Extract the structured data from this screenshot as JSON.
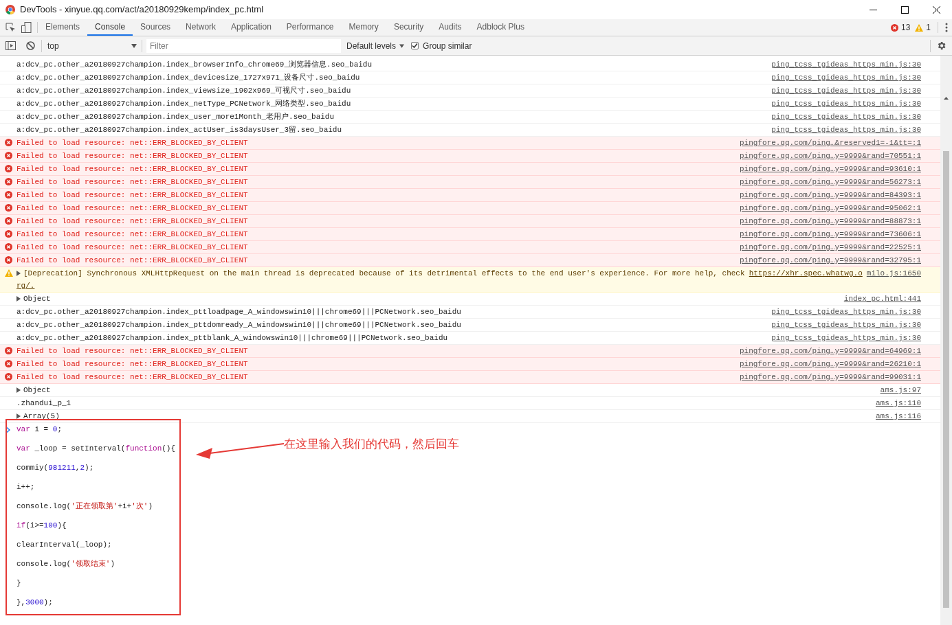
{
  "window": {
    "title": "DevTools - xinyue.qq.com/act/a20180929kemp/index_pc.html"
  },
  "tabs": [
    {
      "label": "Elements",
      "selected": false
    },
    {
      "label": "Console",
      "selected": true
    },
    {
      "label": "Sources",
      "selected": false
    },
    {
      "label": "Network",
      "selected": false
    },
    {
      "label": "Application",
      "selected": false
    },
    {
      "label": "Performance",
      "selected": false
    },
    {
      "label": "Memory",
      "selected": false
    },
    {
      "label": "Security",
      "selected": false
    },
    {
      "label": "Audits",
      "selected": false
    },
    {
      "label": "Adblock Plus",
      "selected": false
    }
  ],
  "counts": {
    "errors": "13",
    "warnings": "1"
  },
  "toolbar": {
    "context": "top",
    "filter_placeholder": "Filter",
    "levels": "Default levels",
    "group_similar": {
      "label": "Group similar",
      "checked": true
    }
  },
  "messages": [
    {
      "kind": "log",
      "text": "a:dcv_pc.other_a20180927champion.index_browserInfo_chrome69_浏览器信息.seo_baidu",
      "source": "ping_tcss_tgideas_https_min.js:30"
    },
    {
      "kind": "log",
      "text": "a:dcv_pc.other_a20180927champion.index_devicesize_1727x971_设备尺寸.seo_baidu",
      "source": "ping_tcss_tgideas_https_min.js:30"
    },
    {
      "kind": "log",
      "text": "a:dcv_pc.other_a20180927champion.index_viewsize_1902x969_可视尺寸.seo_baidu",
      "source": "ping_tcss_tgideas_https_min.js:30"
    },
    {
      "kind": "log",
      "text": "a:dcv_pc.other_a20180927champion.index_netType_PCNetwork_网络类型.seo_baidu",
      "source": "ping_tcss_tgideas_https_min.js:30"
    },
    {
      "kind": "log",
      "text": "a:dcv_pc.other_a20180927champion.index_user_more1Month_老用户.seo_baidu",
      "source": "ping_tcss_tgideas_https_min.js:30"
    },
    {
      "kind": "log",
      "text": "a:dcv_pc.other_a20180927champion.index_actUser_is3daysUser_3留.seo_baidu",
      "source": "ping_tcss_tgideas_https_min.js:30"
    },
    {
      "kind": "error",
      "text": "Failed to load resource: net::ERR_BLOCKED_BY_CLIENT",
      "source": "pingfore.qq.com/ping…&reserved1=-1&tt=:1"
    },
    {
      "kind": "error",
      "text": "Failed to load resource: net::ERR_BLOCKED_BY_CLIENT",
      "source": "pingfore.qq.com/ping…y=9999&rand=70551:1"
    },
    {
      "kind": "error",
      "text": "Failed to load resource: net::ERR_BLOCKED_BY_CLIENT",
      "source": "pingfore.qq.com/ping…y=9999&rand=93610:1"
    },
    {
      "kind": "error",
      "text": "Failed to load resource: net::ERR_BLOCKED_BY_CLIENT",
      "source": "pingfore.qq.com/ping…y=9999&rand=56273:1"
    },
    {
      "kind": "error",
      "text": "Failed to load resource: net::ERR_BLOCKED_BY_CLIENT",
      "source": "pingfore.qq.com/ping…y=9999&rand=84393:1"
    },
    {
      "kind": "error",
      "text": "Failed to load resource: net::ERR_BLOCKED_BY_CLIENT",
      "source": "pingfore.qq.com/ping…y=9999&rand=95062:1"
    },
    {
      "kind": "error",
      "text": "Failed to load resource: net::ERR_BLOCKED_BY_CLIENT",
      "source": "pingfore.qq.com/ping…y=9999&rand=88873:1"
    },
    {
      "kind": "error",
      "text": "Failed to load resource: net::ERR_BLOCKED_BY_CLIENT",
      "source": "pingfore.qq.com/ping…y=9999&rand=73606:1"
    },
    {
      "kind": "error",
      "text": "Failed to load resource: net::ERR_BLOCKED_BY_CLIENT",
      "source": "pingfore.qq.com/ping…y=9999&rand=22525:1"
    },
    {
      "kind": "error",
      "text": "Failed to load resource: net::ERR_BLOCKED_BY_CLIENT",
      "source": "pingfore.qq.com/ping…y=9999&rand=32795:1"
    },
    {
      "kind": "warning",
      "text": "[Deprecation] Synchronous XMLHttpRequest on the main thread is deprecated because of its detrimental effects to the end user's experience. For more help, check",
      "link": "https://xhr.spec.whatwg.o",
      "link_continued": "rg/.",
      "source": "milo.js:1650"
    },
    {
      "kind": "object",
      "text": "Object",
      "source": "index_pc.html:441"
    },
    {
      "kind": "log",
      "text": "a:dcv_pc.other_a20180927champion.index_pttloadpage_A_windowswin10|||chrome69|||PCNetwork.seo_baidu",
      "source": "ping_tcss_tgideas_https_min.js:30"
    },
    {
      "kind": "log",
      "text": "a:dcv_pc.other_a20180927champion.index_pttdomready_A_windowswin10|||chrome69|||PCNetwork.seo_baidu",
      "source": "ping_tcss_tgideas_https_min.js:30"
    },
    {
      "kind": "log",
      "text": "a:dcv_pc.other_a20180927champion.index_pttblank_A_windowswin10|||chrome69|||PCNetwork.seo_baidu",
      "source": "ping_tcss_tgideas_https_min.js:30"
    },
    {
      "kind": "error",
      "text": "Failed to load resource: net::ERR_BLOCKED_BY_CLIENT",
      "source": "pingfore.qq.com/ping…y=9999&rand=64969:1"
    },
    {
      "kind": "error",
      "text": "Failed to load resource: net::ERR_BLOCKED_BY_CLIENT",
      "source": "pingfore.qq.com/ping…y=9999&rand=26210:1"
    },
    {
      "kind": "error",
      "text": "Failed to load resource: net::ERR_BLOCKED_BY_CLIENT",
      "source": "pingfore.qq.com/ping…y=9999&rand=99031:1"
    },
    {
      "kind": "object",
      "text": "Object",
      "source": "ams.js:97"
    },
    {
      "kind": "log",
      "text": ".zhandui_p_1",
      "source": "ams.js:110"
    },
    {
      "kind": "object",
      "text": "Array(5)",
      "source": "ams.js:116"
    }
  ],
  "input_code": [
    [
      {
        "kind": "keyword",
        "text": "var"
      },
      {
        "kind": "plain",
        "text": " i = "
      },
      {
        "kind": "number",
        "text": "0"
      },
      {
        "kind": "plain",
        "text": ";"
      }
    ],
    [
      {
        "kind": "keyword",
        "text": "var"
      },
      {
        "kind": "plain",
        "text": " _loop = setInterval("
      },
      {
        "kind": "keyword",
        "text": "function"
      },
      {
        "kind": "plain",
        "text": "(){"
      }
    ],
    [
      {
        "kind": "plain",
        "text": "commiy("
      },
      {
        "kind": "number",
        "text": "981211"
      },
      {
        "kind": "plain",
        "text": ","
      },
      {
        "kind": "number",
        "text": "2"
      },
      {
        "kind": "plain",
        "text": ");"
      }
    ],
    [
      {
        "kind": "plain",
        "text": "i++;"
      }
    ],
    [
      {
        "kind": "plain",
        "text": "console.log("
      },
      {
        "kind": "string",
        "text": "'正在领取第'"
      },
      {
        "kind": "plain",
        "text": "+i+"
      },
      {
        "kind": "string",
        "text": "'次'"
      },
      {
        "kind": "plain",
        "text": ")"
      }
    ],
    [
      {
        "kind": "keyword",
        "text": "if"
      },
      {
        "kind": "plain",
        "text": "(i>="
      },
      {
        "kind": "number",
        "text": "100"
      },
      {
        "kind": "plain",
        "text": "){"
      }
    ],
    [
      {
        "kind": "plain",
        "text": "clearInterval(_loop);"
      }
    ],
    [
      {
        "kind": "plain",
        "text": "console.log("
      },
      {
        "kind": "string",
        "text": "'领取结束'"
      },
      {
        "kind": "plain",
        "text": ")"
      }
    ],
    [
      {
        "kind": "plain",
        "text": "}"
      }
    ],
    [
      {
        "kind": "plain",
        "text": "},"
      },
      {
        "kind": "number",
        "text": "3000"
      },
      {
        "kind": "plain",
        "text": ");"
      }
    ]
  ],
  "annotation": {
    "text": "在这里输入我们的代码，然后回车"
  }
}
